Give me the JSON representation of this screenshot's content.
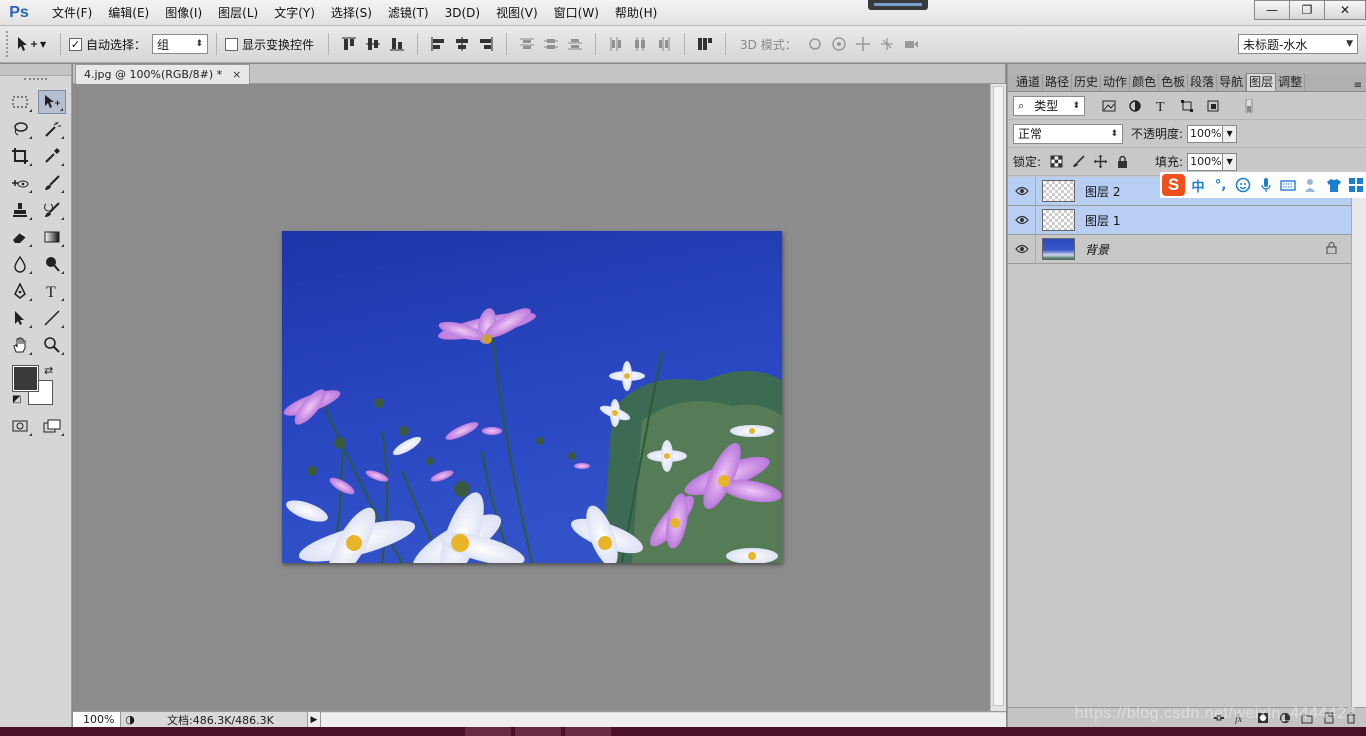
{
  "app": {
    "logo": "Ps"
  },
  "menubar": {
    "items": [
      "文件(F)",
      "编辑(E)",
      "图像(I)",
      "图层(L)",
      "文字(Y)",
      "选择(S)",
      "滤镜(T)",
      "3D(D)",
      "视图(V)",
      "窗口(W)",
      "帮助(H)"
    ],
    "window_controls": {
      "minimize": "—",
      "maximize": "❐",
      "close": "✕"
    }
  },
  "options": {
    "auto_select_label": "自动选择：",
    "auto_select_checked": true,
    "auto_select_target": "组",
    "show_transform_label": "显示变换控件",
    "show_transform_checked": false,
    "mode_3d_label": "3D 模式：",
    "workspace": "未标题-水水"
  },
  "document": {
    "tab_title": "4.jpg @ 100%(RGB/8#) *",
    "close_glyph": "×",
    "zoom": "100%",
    "doc_size": "文档:486.3K/486.3K",
    "status_menu_arrow": "▶"
  },
  "panel": {
    "tabs": [
      "通道",
      "路径",
      "历史",
      "动作",
      "颜色",
      "色板",
      "段落",
      "导航",
      "图层",
      "调整"
    ],
    "active_tab": "图层",
    "filter_type": "类型",
    "blend_mode": "正常",
    "opacity_label": "不透明度:",
    "opacity": "100%",
    "lock_label": "锁定:",
    "fill_label": "填充:",
    "fill": "100%",
    "layers": [
      {
        "name": "图层 2",
        "visible": true,
        "selected": true,
        "locked": false,
        "kind": "transparent"
      },
      {
        "name": "图层 1",
        "visible": true,
        "selected": true,
        "locked": false,
        "kind": "transparent"
      },
      {
        "name": "背景",
        "visible": true,
        "selected": false,
        "locked": true,
        "kind": "photo"
      }
    ]
  },
  "ime": {
    "logo": "S",
    "lang": "中",
    "punct": "°,"
  },
  "watermark": "https://blog.csdn.net/weixin_4444427",
  "colors": {
    "foreground": "#3a3a3a",
    "background": "#ffffff",
    "selected_layer": "#b8cef2",
    "canvas_bg": "#8c8c8c",
    "accent": "#2b63b8"
  }
}
